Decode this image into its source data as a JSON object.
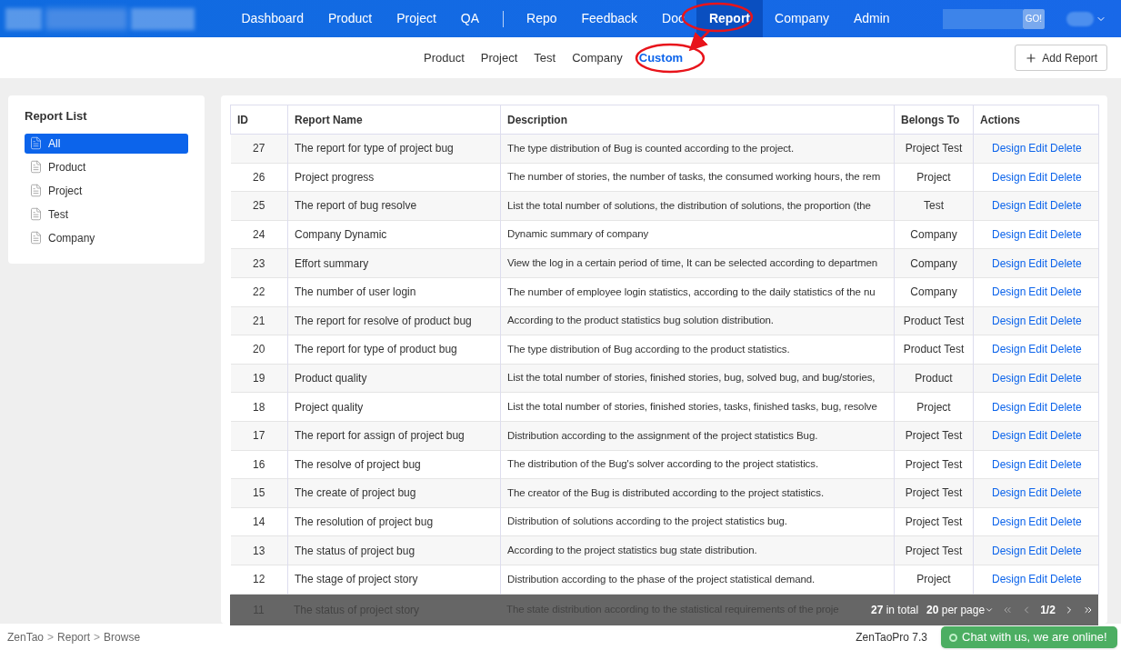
{
  "nav": {
    "groups": [
      [
        {
          "label": "Dashboard",
          "selected": false
        },
        {
          "label": "Product",
          "selected": false
        },
        {
          "label": "Project",
          "selected": false
        },
        {
          "label": "QA",
          "selected": false
        }
      ],
      [
        {
          "label": "Repo",
          "selected": false
        },
        {
          "label": "Feedback",
          "selected": false
        },
        {
          "label": "Doc",
          "selected": false
        },
        {
          "label": "Report",
          "selected": true
        },
        {
          "label": "Company",
          "selected": false
        },
        {
          "label": "Admin",
          "selected": false
        }
      ]
    ],
    "search_button": "GO!"
  },
  "subnav": {
    "tabs": [
      {
        "label": "Product",
        "selected": false
      },
      {
        "label": "Project",
        "selected": false
      },
      {
        "label": "Test",
        "selected": false
      },
      {
        "label": "Company",
        "selected": false
      },
      {
        "label": "Custom",
        "selected": true
      }
    ],
    "add_button": "Add Report"
  },
  "sidebar": {
    "title": "Report List",
    "items": [
      {
        "label": "All",
        "selected": true
      },
      {
        "label": "Product",
        "selected": false
      },
      {
        "label": "Project",
        "selected": false
      },
      {
        "label": "Test",
        "selected": false
      },
      {
        "label": "Company",
        "selected": false
      }
    ]
  },
  "table": {
    "columns": [
      "ID",
      "Report Name",
      "Description",
      "Belongs To",
      "Actions"
    ],
    "rows": [
      {
        "id": "27",
        "name": "The report for type of project bug",
        "description": "The type distribution of Bug is counted according to the project.",
        "belongs_to": "Project Test",
        "actions": [
          "Design",
          "Edit",
          "Delete"
        ]
      },
      {
        "id": "26",
        "name": "Project progress",
        "description": "The number of stories, the number of tasks, the consumed working hours, the rem",
        "belongs_to": "Project",
        "actions": [
          "Design",
          "Edit",
          "Delete"
        ]
      },
      {
        "id": "25",
        "name": "The report of bug resolve",
        "description": "List the total number of solutions, the distribution of solutions, the proportion (the",
        "belongs_to": "Test",
        "actions": [
          "Design",
          "Edit",
          "Delete"
        ]
      },
      {
        "id": "24",
        "name": "Company Dynamic",
        "description": "Dynamic summary of company",
        "belongs_to": "Company",
        "actions": [
          "Design",
          "Edit",
          "Delete"
        ]
      },
      {
        "id": "23",
        "name": "Effort summary",
        "description": "View the log in a certain period of time, It can be selected according to departmen",
        "belongs_to": "Company",
        "actions": [
          "Design",
          "Edit",
          "Delete"
        ]
      },
      {
        "id": "22",
        "name": "The number of user login",
        "description": "The number of employee login statistics, according to the daily statistics of the nu",
        "belongs_to": "Company",
        "actions": [
          "Design",
          "Edit",
          "Delete"
        ]
      },
      {
        "id": "21",
        "name": "The report for resolve of product bug",
        "description": "According to the product statistics bug solution distribution.",
        "belongs_to": "Product Test",
        "actions": [
          "Design",
          "Edit",
          "Delete"
        ]
      },
      {
        "id": "20",
        "name": "The report for type of product bug",
        "description": "The type distribution of Bug according to the product statistics.",
        "belongs_to": "Product Test",
        "actions": [
          "Design",
          "Edit",
          "Delete"
        ]
      },
      {
        "id": "19",
        "name": "Product quality",
        "description": "List the total number of stories, finished stories, bug, solved bug, and bug/stories,",
        "belongs_to": "Product",
        "actions": [
          "Design",
          "Edit",
          "Delete"
        ]
      },
      {
        "id": "18",
        "name": "Project quality",
        "description": "List the total number of stories, finished stories, tasks, finished tasks, bug, resolve",
        "belongs_to": "Project",
        "actions": [
          "Design",
          "Edit",
          "Delete"
        ]
      },
      {
        "id": "17",
        "name": "The report for assign of project bug",
        "description": "Distribution according to the assignment of the project statistics Bug.",
        "belongs_to": "Project Test",
        "actions": [
          "Design",
          "Edit",
          "Delete"
        ]
      },
      {
        "id": "16",
        "name": "The resolve of project bug",
        "description": "The distribution of the Bug's solver according to the project statistics.",
        "belongs_to": "Project Test",
        "actions": [
          "Design",
          "Edit",
          "Delete"
        ]
      },
      {
        "id": "15",
        "name": "The create of project bug",
        "description": "The creator of the Bug is distributed according to the project statistics.",
        "belongs_to": "Project Test",
        "actions": [
          "Design",
          "Edit",
          "Delete"
        ]
      },
      {
        "id": "14",
        "name": "The resolution of project bug",
        "description": "Distribution of solutions according to the project statistics bug.",
        "belongs_to": "Project Test",
        "actions": [
          "Design",
          "Edit",
          "Delete"
        ]
      },
      {
        "id": "13",
        "name": "The status of project bug",
        "description": "According to the project statistics bug state distribution.",
        "belongs_to": "Project Test",
        "actions": [
          "Design",
          "Edit",
          "Delete"
        ]
      },
      {
        "id": "12",
        "name": "The stage of project story",
        "description": "Distribution according to the phase of the project statistical demand.",
        "belongs_to": "Project",
        "actions": [
          "Design",
          "Edit",
          "Delete"
        ]
      }
    ],
    "covered_row": {
      "id": "11",
      "name": "The status of project story",
      "description": "The state distribution according to the statistical requirements of the proje"
    }
  },
  "pager": {
    "total": "**27** in total",
    "per_page": "**20** per page",
    "page": "1/2"
  },
  "footer": {
    "breadcrumb": [
      "ZenTao",
      "Report",
      "Browse"
    ],
    "separator": ">",
    "version": "ZenTaoPro 7.3",
    "chat": "Chat with us, we are online!"
  }
}
